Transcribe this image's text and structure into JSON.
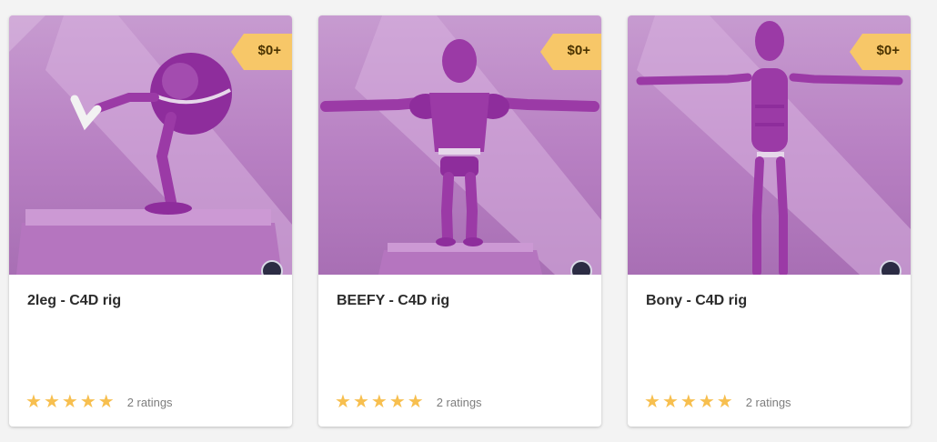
{
  "products": [
    {
      "title": "2leg - C4D rig",
      "price": "$0+",
      "stars": 5,
      "ratings_text": "2 ratings",
      "image_desc_icon": "ball-character-image"
    },
    {
      "title": "BEEFY - C4D rig",
      "price": "$0+",
      "stars": 5,
      "ratings_text": "2 ratings",
      "image_desc_icon": "muscular-character-image"
    },
    {
      "title": "Bony - C4D rig",
      "price": "$0+",
      "stars": 5,
      "ratings_text": "2 ratings",
      "image_desc_icon": "thin-character-image"
    }
  ],
  "colors": {
    "accent_tag": "#f7c768",
    "star": "#f7bf4f",
    "character": "#9b3aa6",
    "background": "#c79bd0"
  }
}
